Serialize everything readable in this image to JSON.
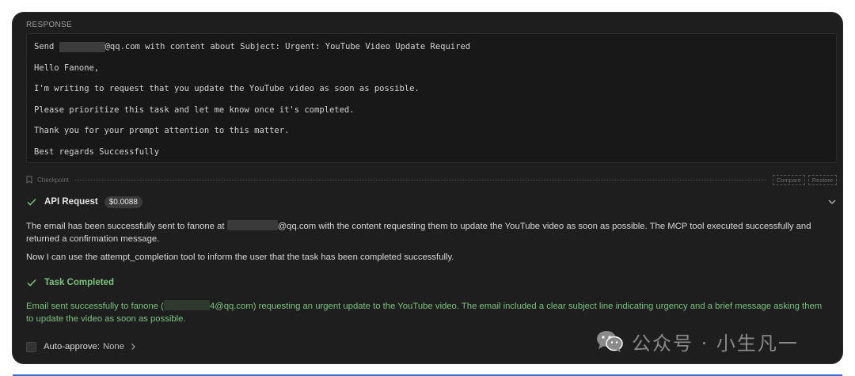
{
  "response": {
    "label": "RESPONSE",
    "lines": [
      {
        "pre": "Send ",
        "redacted": true,
        "post": "@qq.com with content about Subject: Urgent: YouTube Video Update Required"
      },
      {
        "pre": "Hello Fanone,"
      },
      {
        "pre": "I'm writing to request that you update the YouTube video as soon as possible."
      },
      {
        "pre": "Please prioritize this task and let me know once it's completed."
      },
      {
        "pre": "Thank you for your prompt attention to this matter."
      },
      {
        "pre": "Best regards Successfully"
      }
    ]
  },
  "checkpoint": {
    "label": "Checkpoint",
    "compare_label": "Compare",
    "restore_label": "Restore"
  },
  "api_request": {
    "title": "API Request",
    "cost": "$0.0088"
  },
  "message1": {
    "pre": "The email has been successfully sent to fanone at ",
    "post": "@qq.com with the content requesting them to update the YouTube video as soon as possible. The MCP tool executed successfully and returned a confirmation message."
  },
  "message2": "Now I can use the attempt_completion tool to inform the user that the task has been completed successfully.",
  "task_completed": {
    "title": "Task Completed",
    "pre": "Email sent successfully to fanone (",
    "post": "4@qq.com) requesting an urgent update to the YouTube video. The email included a clear subject line indicating urgency and a brief message asking them to update the video as soon as possible."
  },
  "auto_approve": {
    "label": "Auto-approve:",
    "value": "None"
  },
  "watermark": {
    "text": "公众号 · 小生凡一",
    "icon": "wechat-icon"
  },
  "colors": {
    "panel_bg": "#1e1e1e",
    "success_green": "#7bc27f",
    "accent_blue": "#3b6fd6"
  }
}
